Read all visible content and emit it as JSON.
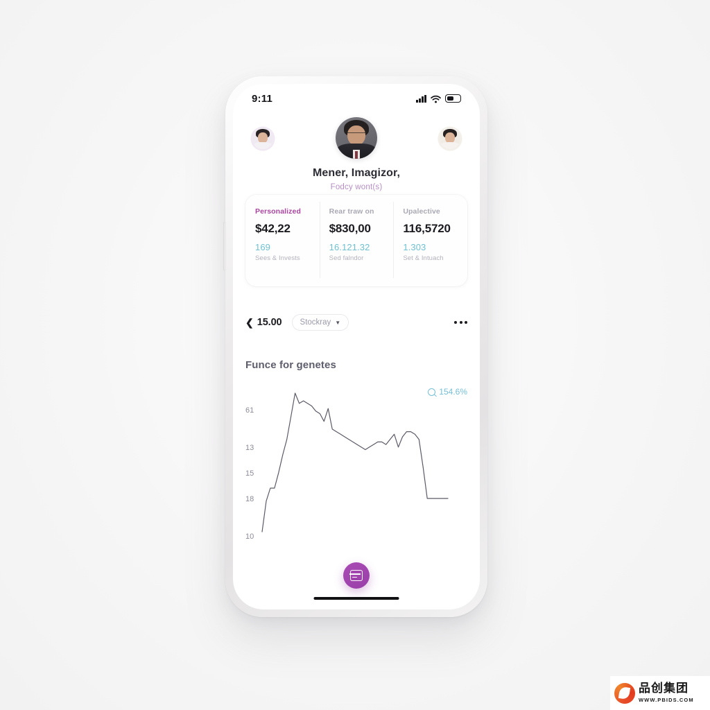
{
  "statusbar": {
    "time": "9:11",
    "signal_icon": "cellular-bars-icon",
    "wifi_icon": "wifi-icon",
    "battery_icon": "battery-icon"
  },
  "header": {
    "avatar_main": "profile-avatar",
    "avatar_left": "contact-avatar-left",
    "avatar_right": "contact-avatar-right",
    "name": "Mener, Imagizor,",
    "subtitle": "Fodcy wont(s)"
  },
  "stats": [
    {
      "label": "Personalized",
      "value": "$42,22",
      "sub": "169",
      "caption": "Sees & Invests",
      "accent": "#a8479e"
    },
    {
      "label": "Rear traw on",
      "value": "$830,00",
      "sub": "16.121.32",
      "caption": "Sed falndor",
      "accent": "#a9a9b4"
    },
    {
      "label": "Upalective",
      "value": "116,5720",
      "sub": "1.303",
      "caption": "Set & Intuach",
      "accent": "#a9a9b4"
    }
  ],
  "toolbar": {
    "back_icon": "chevron-left-icon",
    "price": "15.00",
    "market_label": "Stockray",
    "dropdown_icon": "caret-down-icon",
    "more_icon": "more-options-icon"
  },
  "section": {
    "title": "Funce for genetes"
  },
  "chart_data": {
    "type": "line",
    "title": "Funce for genetes",
    "delta_label": "154.6%",
    "delta_icon": "magnifier-icon",
    "ytick_labels": [
      "61",
      "13",
      "15",
      "18",
      "10"
    ],
    "ytick_positions": [
      126,
      288,
      398,
      509,
      670
    ],
    "line_color": "#5a5a66",
    "grid": false,
    "legend": false,
    "x": [
      0,
      1,
      2,
      3,
      4,
      5,
      6,
      7,
      8,
      9,
      10,
      11,
      12,
      13,
      14,
      15,
      16,
      17,
      18,
      19,
      20,
      21,
      22,
      23,
      24,
      25,
      26,
      27,
      28,
      29,
      30,
      31,
      32,
      33,
      34,
      35,
      36,
      37,
      38,
      39,
      40,
      41,
      42,
      43,
      44,
      45
    ],
    "values": [
      20,
      32,
      37,
      37,
      43,
      50,
      56,
      65,
      74,
      70,
      71,
      70,
      69,
      67,
      66,
      63,
      68,
      60,
      59,
      58,
      57,
      56,
      55,
      54,
      53,
      52,
      53,
      54,
      55,
      55,
      54,
      56,
      58,
      53,
      57,
      59,
      59,
      58,
      56,
      45,
      33,
      33,
      33,
      33,
      33,
      33
    ]
  },
  "fab": {
    "icon": "card-stack-icon",
    "color": "#9a3fa8"
  },
  "home_indicator": "home-indicator",
  "watermark": {
    "logo_icon": "pbids-leaf-logo-icon",
    "brand_cn": "品创集团",
    "url": "WWW.PBIDS.COM"
  }
}
